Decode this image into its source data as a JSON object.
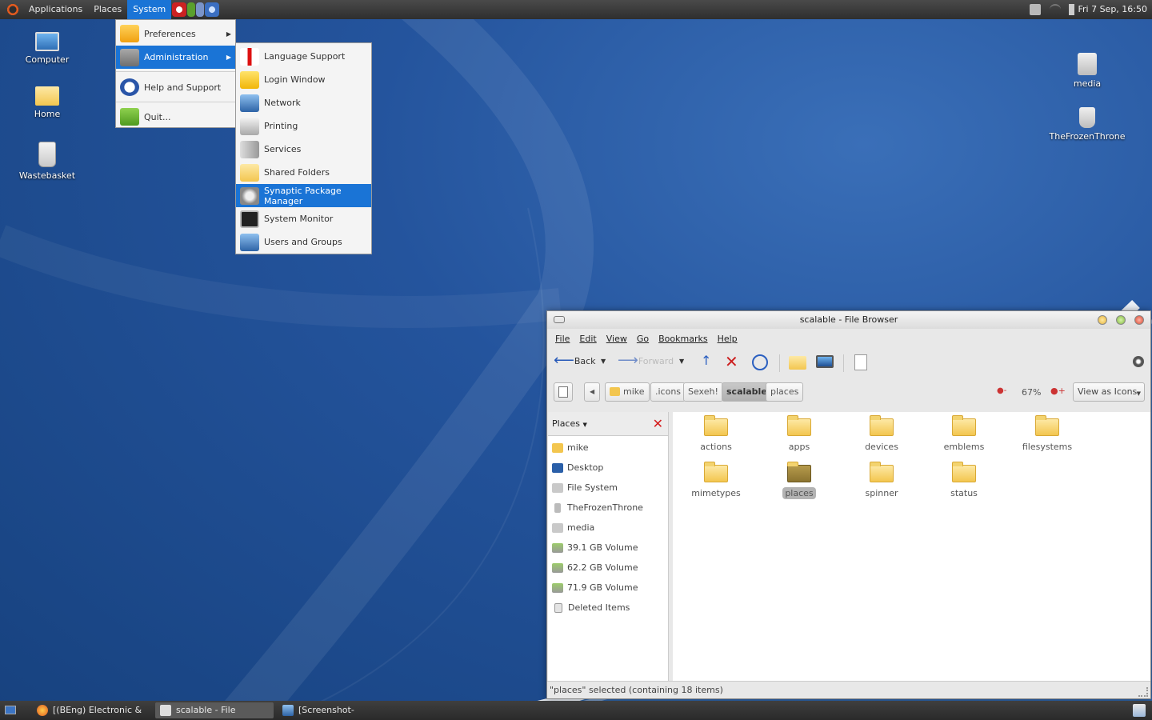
{
  "top_panel": {
    "menus": [
      "Applications",
      "Places",
      "System"
    ],
    "clock": "Fri  7 Sep, 16:50"
  },
  "desktop_icons": {
    "computer": "Computer",
    "home": "Home",
    "wastebasket": "Wastebasket",
    "media": "media",
    "frozen": "TheFrozenThrone"
  },
  "system_menu": {
    "items": [
      "Preferences",
      "Administration",
      "Help and Support",
      "Quit..."
    ]
  },
  "admin_menu": {
    "items": [
      "Language Support",
      "Login Window",
      "Network",
      "Printing",
      "Services",
      "Shared Folders",
      "Synaptic Package Manager",
      "System Monitor",
      "Users and Groups"
    ]
  },
  "file_browser": {
    "title": "scalable - File Browser",
    "menubar": [
      "File",
      "Edit",
      "View",
      "Go",
      "Bookmarks",
      "Help"
    ],
    "toolbar": {
      "back": "Back",
      "forward": "Forward"
    },
    "breadcrumbs": [
      "mike",
      ".icons",
      "Sexeh!",
      "scalable",
      "places"
    ],
    "zoom": "67%",
    "view_mode": "View as Icons",
    "sidebar_title": "Places",
    "places": [
      "mike",
      "Desktop",
      "File System",
      "TheFrozenThrone",
      "media",
      "39.1 GB Volume",
      "62.2 GB Volume",
      "71.9 GB Volume",
      "Deleted Items"
    ],
    "folders": [
      "actions",
      "apps",
      "devices",
      "emblems",
      "filesystems",
      "mimetypes",
      "places",
      "spinner",
      "status"
    ],
    "status": "\"places\" selected (containing 18 items)"
  },
  "taskbar": {
    "items": [
      "[(BEng) Electronic & ...",
      "scalable - File Browser",
      "[Screenshot-Xnest.jpg..."
    ]
  },
  "colors": {
    "accent": "#1a74d6",
    "desktop": "#24549d",
    "folder": "#f3c64f"
  }
}
